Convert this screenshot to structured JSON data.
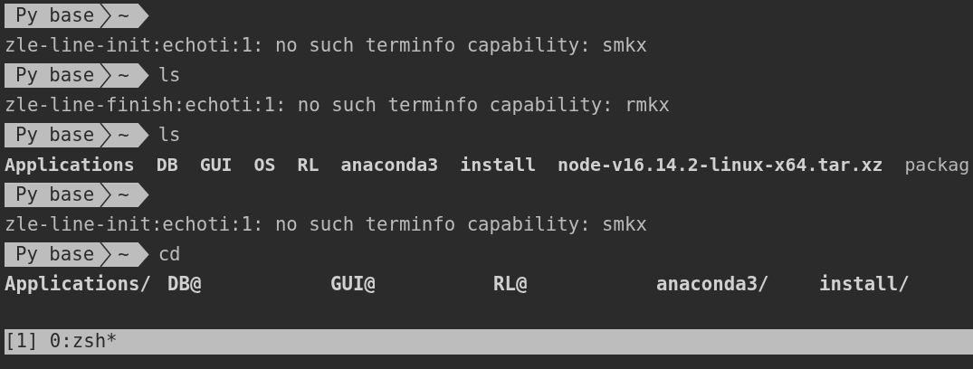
{
  "lines": [
    {
      "kind": "prompt",
      "segment": "Py base",
      "dir": "~"
    },
    {
      "kind": "output",
      "text": "zle-line-init:echoti:1: no such terminfo capability: smkx"
    },
    {
      "kind": "prompt",
      "segment": "Py base",
      "dir": "~",
      "command": "ls"
    },
    {
      "kind": "output",
      "text": "zle-line-finish:echoti:1: no such terminfo capability: rmkx"
    },
    {
      "kind": "prompt",
      "segment": "Py base",
      "dir": "~",
      "command": "ls"
    },
    {
      "kind": "listing",
      "items": [
        {
          "text": "Applications",
          "bold": true
        },
        {
          "text": "DB",
          "bold": true
        },
        {
          "text": "GUI",
          "bold": true
        },
        {
          "text": "OS",
          "bold": true
        },
        {
          "text": "RL",
          "bold": true
        },
        {
          "text": "anaconda3",
          "bold": true
        },
        {
          "text": "install",
          "bold": true
        },
        {
          "text": "node-v16.14.2-linux-x64.tar.xz",
          "bold": true
        },
        {
          "text": "packag",
          "bold": false
        }
      ]
    },
    {
      "kind": "prompt",
      "segment": "Py base",
      "dir": "~"
    },
    {
      "kind": "output",
      "text": "zle-line-init:echoti:1: no such terminfo capability: smkx"
    },
    {
      "kind": "prompt",
      "segment": "Py base",
      "dir": "~",
      "command": "cd"
    },
    {
      "kind": "columns",
      "items": [
        {
          "text": "Applications/",
          "bold": true
        },
        {
          "text": "DB@",
          "bold": true
        },
        {
          "text": "GUI@",
          "bold": true
        },
        {
          "text": "RL@",
          "bold": true
        },
        {
          "text": "anaconda3/",
          "bold": true
        },
        {
          "text": "install/",
          "bold": true
        }
      ]
    }
  ],
  "status_bar": {
    "text": "[1] 0:zsh*"
  }
}
